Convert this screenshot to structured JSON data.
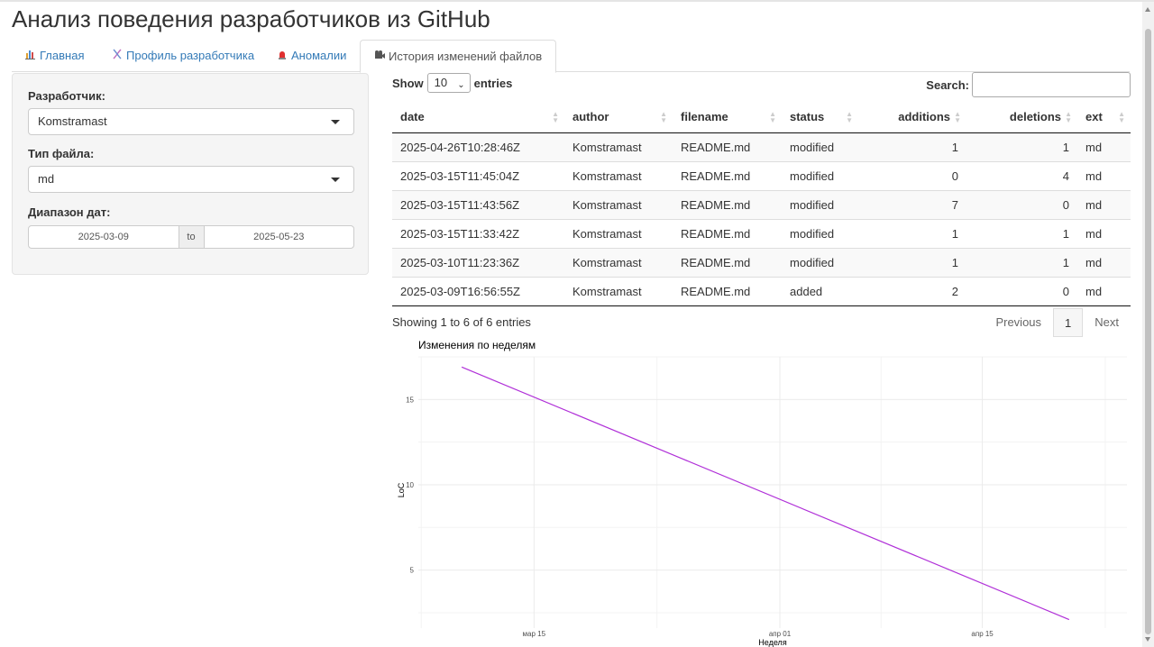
{
  "app": {
    "title": "Анализ поведения разработчиков из GitHub"
  },
  "tabs": [
    {
      "label": "Главная",
      "icon": "bar-chart-icon",
      "active": false
    },
    {
      "label": "Профиль разработчика",
      "icon": "dna-icon",
      "active": false
    },
    {
      "label": "Аномалии",
      "icon": "alarm-icon",
      "active": false
    },
    {
      "label": "История изменений файлов",
      "icon": "film-reel-icon",
      "active": true
    }
  ],
  "sidebar": {
    "developer_label": "Разработчик:",
    "developer_value": "Komstramast",
    "filetype_label": "Тип файла:",
    "filetype_value": "md",
    "daterange_label": "Диапазон дат:",
    "date_from": "2025-03-09",
    "date_sep": "to",
    "date_to": "2025-05-23"
  },
  "table": {
    "show_label": "Show",
    "page_length": "10",
    "entries_label": "entries",
    "search_label": "Search:",
    "search_value": "",
    "columns": [
      "date",
      "author",
      "filename",
      "status",
      "additions",
      "deletions",
      "ext"
    ],
    "rows": [
      [
        "2025-04-26T10:28:46Z",
        "Komstramast",
        "README.md",
        "modified",
        "1",
        "1",
        "md"
      ],
      [
        "2025-03-15T11:45:04Z",
        "Komstramast",
        "README.md",
        "modified",
        "0",
        "4",
        "md"
      ],
      [
        "2025-03-15T11:43:56Z",
        "Komstramast",
        "README.md",
        "modified",
        "7",
        "0",
        "md"
      ],
      [
        "2025-03-15T11:33:42Z",
        "Komstramast",
        "README.md",
        "modified",
        "1",
        "1",
        "md"
      ],
      [
        "2025-03-10T11:23:36Z",
        "Komstramast",
        "README.md",
        "modified",
        "1",
        "1",
        "md"
      ],
      [
        "2025-03-09T16:56:55Z",
        "Komstramast",
        "README.md",
        "added",
        "2",
        "0",
        "md"
      ]
    ],
    "info": "Showing 1 to 6 of 6 entries",
    "prev_label": "Previous",
    "page": "1",
    "next_label": "Next"
  },
  "chart_data": {
    "type": "line",
    "title": "Изменения по неделям",
    "xlabel": "Неделя",
    "ylabel": "LoC",
    "x_ticks": [
      "мар 15",
      "апр 01",
      "апр 15"
    ],
    "y_ticks": [
      5,
      10,
      15
    ],
    "x": [
      "2025-03-10",
      "2025-04-21"
    ],
    "series": [
      {
        "values": [
          16.9,
          2.1
        ]
      }
    ],
    "xlim": [
      "2025-03-07",
      "2025-04-25"
    ],
    "ylim": [
      1.6,
      17.5
    ],
    "grid": true,
    "line_color": "#b030d8"
  },
  "colors": {
    "link": "#337ab7",
    "tab_active_text": "#555555",
    "sidebar_bg": "#f5f5f5"
  }
}
